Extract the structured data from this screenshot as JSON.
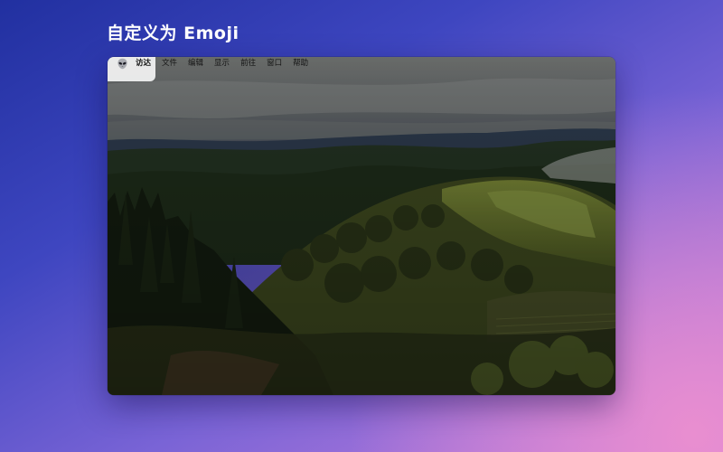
{
  "headline": "自定义为 Emoji",
  "menubar": {
    "icon": "alien-emoji-icon",
    "app_name": "访达",
    "items": [
      "文件",
      "编辑",
      "显示",
      "前往",
      "窗口",
      "帮助"
    ]
  },
  "colors": {
    "background_top": "#2130a0",
    "background_bottom": "#c77fdb",
    "menubar_highlight": "#ffffff"
  }
}
